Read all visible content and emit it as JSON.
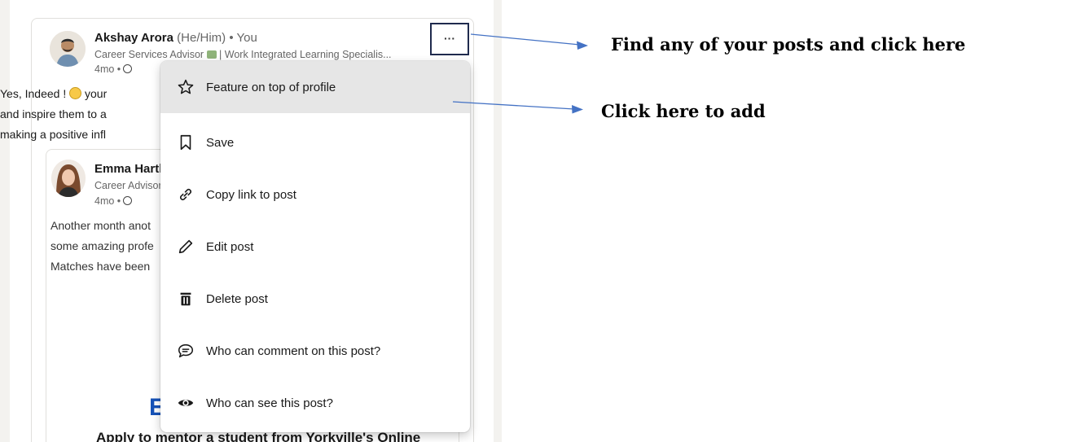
{
  "post": {
    "author_name": "Akshay Arora",
    "author_suffix": " (He/Him) • You",
    "headline_start": "Career Services Advisor",
    "headline_end": "| Work Integrated Learning Specialis...",
    "time": "4mo •",
    "text_lines": [
      "Yes, Indeed !",
      " your",
      "and inspire them to a",
      "making a positive infl"
    ]
  },
  "shared": {
    "author_name": "Emma Hartl",
    "headline": "Career Advisor",
    "time": "4mo •",
    "text_lines": [
      "Another month anot",
      "some amazing profe",
      "Matches have been"
    ],
    "big_letter": "E",
    "cta": "Apply to mentor a student from Yorkville's Online"
  },
  "more_button": {
    "label": "···"
  },
  "menu": {
    "items": [
      {
        "label": "Feature on top of profile",
        "icon": "star-icon"
      },
      {
        "label": "Save",
        "icon": "bookmark-icon"
      },
      {
        "label": "Copy link to post",
        "icon": "link-icon"
      },
      {
        "label": "Edit post",
        "icon": "pencil-icon"
      },
      {
        "label": "Delete post",
        "icon": "trash-icon"
      },
      {
        "label": "Who can comment on this post?",
        "icon": "comment-icon"
      },
      {
        "label": "Who can see this post?",
        "icon": "eye-icon"
      }
    ]
  },
  "annotations": {
    "callout_top": "Find any of your posts and click here",
    "callout_mid": "Click here to add"
  },
  "colors": {
    "arrow": "#4472c4",
    "active_item": "#e6e6e6",
    "button_border": "#1f2a4d"
  }
}
